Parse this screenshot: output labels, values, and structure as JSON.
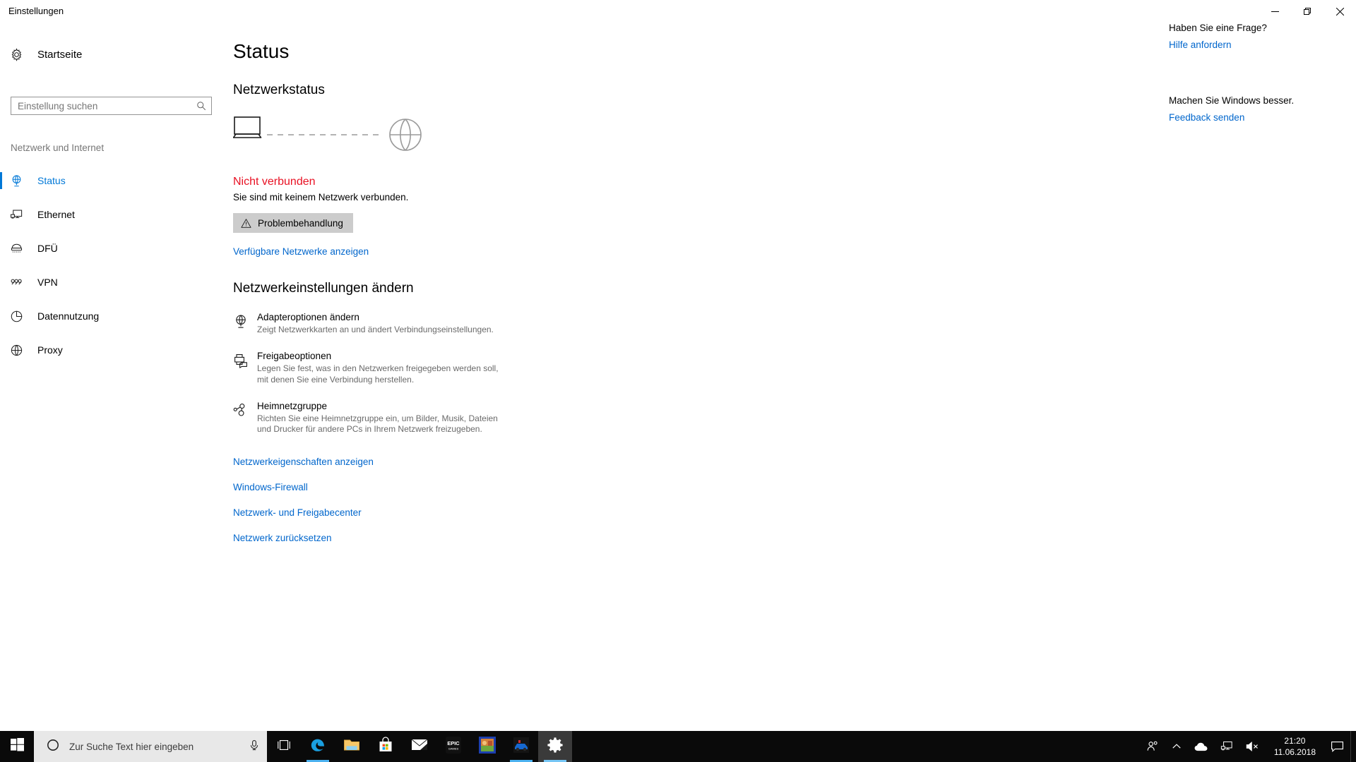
{
  "window": {
    "title": "Einstellungen",
    "minimize_label": "Minimieren",
    "restore_label": "Wiederherstellen",
    "close_label": "Schließen"
  },
  "sidebar": {
    "home_label": "Startseite",
    "home_icon": "gear-icon",
    "search_placeholder": "Einstellung suchen",
    "search_value": "",
    "search_icon": "search-icon",
    "category_label": "Netzwerk und Internet",
    "accent_color": "#0078d7",
    "items": [
      {
        "label": "Status",
        "icon": "globe-network-icon",
        "selected": true
      },
      {
        "label": "Ethernet",
        "icon": "ethernet-icon",
        "selected": false
      },
      {
        "label": "DFÜ",
        "icon": "dialup-icon",
        "selected": false
      },
      {
        "label": "VPN",
        "icon": "vpn-icon",
        "selected": false
      },
      {
        "label": "Datennutzung",
        "icon": "pie-chart-icon",
        "selected": false
      },
      {
        "label": "Proxy",
        "icon": "globe-icon",
        "selected": false
      }
    ]
  },
  "main": {
    "page_title": "Status",
    "network_status_heading": "Netzwerkstatus",
    "diagram": {
      "device_icon": "laptop-icon",
      "internet_icon": "globe-icon",
      "connection_style": "dashed-disconnected",
      "line_color": "#9a9a9a"
    },
    "status_text": "Nicht verbunden",
    "status_color": "#e81123",
    "status_subtext": "Sie sind mit keinem Netzwerk verbunden.",
    "troubleshoot_button": {
      "label": "Problembehandlung",
      "icon": "warning-triangle-icon",
      "background": "#cccccc"
    },
    "available_networks_link": "Verfügbare Netzwerke anzeigen",
    "change_settings_heading": "Netzwerkeinstellungen ändern",
    "settings": [
      {
        "icon": "adapter-globe-icon",
        "title": "Adapteroptionen ändern",
        "desc": "Zeigt Netzwerkkarten an und ändert Verbindungseinstellungen."
      },
      {
        "icon": "printer-share-icon",
        "title": "Freigabeoptionen",
        "desc": "Legen Sie fest, was in den Netzwerken freigegeben werden soll, mit denen Sie eine Verbindung herstellen."
      },
      {
        "icon": "homegroup-icon",
        "title": "Heimnetzgruppe",
        "desc": "Richten Sie eine Heimnetzgruppe ein, um Bilder, Musik, Dateien und Drucker für andere PCs in Ihrem Netzwerk freizugeben."
      }
    ],
    "bottom_links": [
      "Netzwerkeigenschaften anzeigen",
      "Windows-Firewall",
      "Netzwerk- und Freigabecenter",
      "Netzwerk zurücksetzen"
    ],
    "link_color": "#0066cc"
  },
  "right_rail": {
    "question_title": "Haben Sie eine Frage?",
    "question_link": "Hilfe anfordern",
    "feedback_title": "Machen Sie Windows besser.",
    "feedback_link": "Feedback senden"
  },
  "taskbar": {
    "start_icon": "windows-logo-icon",
    "search_placeholder": "Zur Suche Text hier eingeben",
    "search_circle_icon": "cortana-circle-icon",
    "mic_icon": "microphone-icon",
    "apps": [
      {
        "name": "task-view",
        "icon": "task-view-icon",
        "running": false,
        "active": false
      },
      {
        "name": "edge",
        "icon": "edge-icon",
        "running": true,
        "active": false
      },
      {
        "name": "file-explorer",
        "icon": "folder-icon",
        "running": false,
        "active": false
      },
      {
        "name": "microsoft-store",
        "icon": "store-bag-icon",
        "running": false,
        "active": false
      },
      {
        "name": "mail",
        "icon": "mail-envelope-icon",
        "running": false,
        "active": false
      },
      {
        "name": "epic-games",
        "icon": "epic-games-icon",
        "running": false,
        "active": false
      },
      {
        "name": "game-tile-orange",
        "icon": "game-tile-icon",
        "running": false,
        "active": false
      },
      {
        "name": "game-tile-blue",
        "icon": "racing-game-icon",
        "running": true,
        "active": false
      },
      {
        "name": "settings",
        "icon": "gear-icon",
        "running": true,
        "active": true
      }
    ],
    "tray": {
      "people_icon": "people-icon",
      "overflow_icon": "chevron-up-icon",
      "onedrive_icon": "cloud-icon",
      "network_icon": "ethernet-icon",
      "volume_icon": "speaker-muted-icon",
      "time": "21:20",
      "date": "11.06.2018",
      "notifications_icon": "notification-bell-icon"
    }
  }
}
